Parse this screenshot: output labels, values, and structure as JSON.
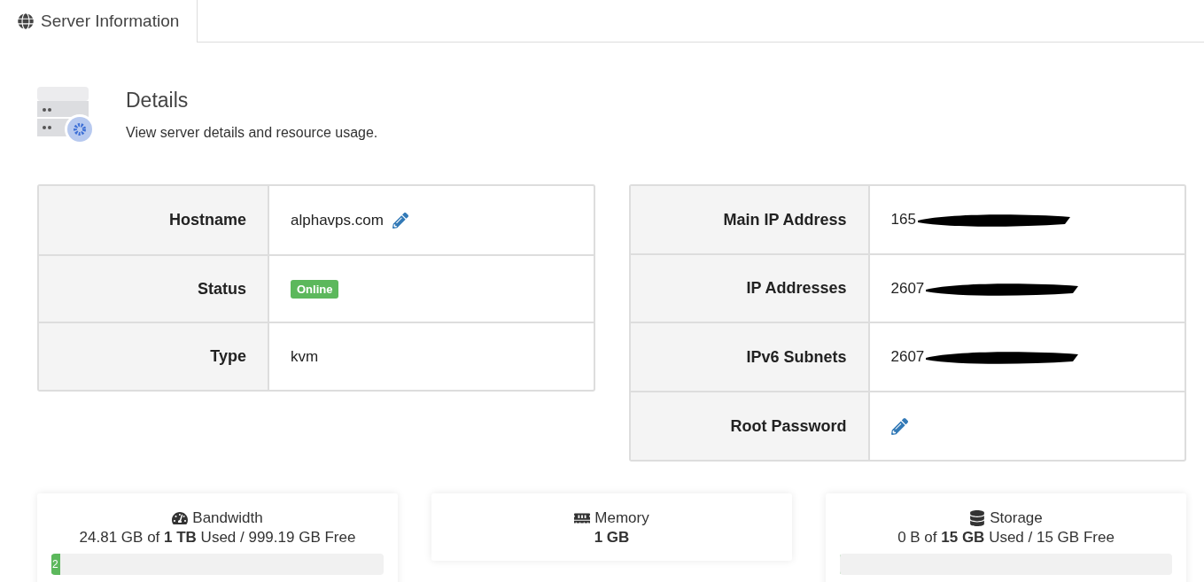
{
  "tabs": [
    {
      "label": "Server Information",
      "selected": true
    }
  ],
  "header": {
    "title": "Details",
    "subtitle": "View server details and resource usage."
  },
  "details_left": [
    {
      "label": "Hostname",
      "value": "alphavps.com",
      "kind": "editable"
    },
    {
      "label": "Status",
      "value": "Online",
      "kind": "badge"
    },
    {
      "label": "Type",
      "value": "kvm",
      "kind": "text"
    }
  ],
  "details_right": [
    {
      "label": "Main IP Address",
      "value": "165",
      "kind": "redacted"
    },
    {
      "label": "IP Addresses",
      "value": "2607",
      "kind": "redacted"
    },
    {
      "label": "IPv6 Subnets",
      "value": "2607",
      "kind": "redacted"
    },
    {
      "label": "Root Password",
      "kind": "edit"
    }
  ],
  "resources": [
    {
      "title": "Bandwidth",
      "kind": "bandwidth",
      "usage": "24.81 GB of **1 TB** Used / 999.19 GB Free",
      "level": 0.024,
      "bar_label": "2"
    },
    {
      "title": "Memory",
      "kind": "memory",
      "usage": "**1 GB**"
    },
    {
      "title": "Storage",
      "kind": "storage",
      "usage": "0 B of **15 GB** Used / 15 GB Free",
      "level": 0
    }
  ]
}
